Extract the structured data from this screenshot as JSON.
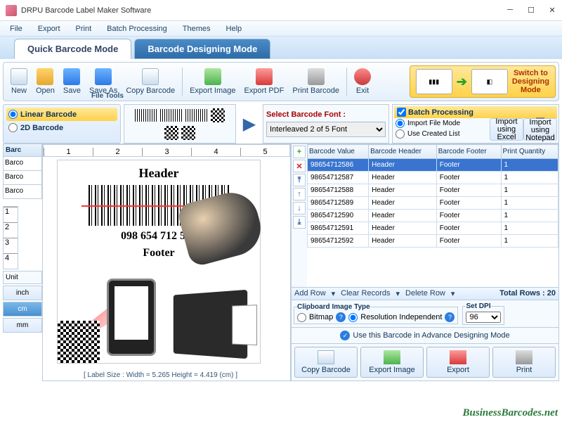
{
  "window": {
    "title": "DRPU Barcode Label Maker Software"
  },
  "menu": [
    "File",
    "Export",
    "Print",
    "Batch Processing",
    "Themes",
    "Help"
  ],
  "tabs": {
    "quick": "Quick Barcode Mode",
    "design": "Barcode Designing Mode"
  },
  "toolbar": {
    "new": "New",
    "open": "Open",
    "save": "Save",
    "saveas": "Save As",
    "copy": "Copy Barcode",
    "expimg": "Export Image",
    "exppdf": "Export PDF",
    "print": "Print Barcode",
    "exit": "Exit",
    "group": "File Tools"
  },
  "switch": {
    "line1": "Switch to",
    "line2": "Designing",
    "line3": "Mode"
  },
  "type": {
    "linear": "Linear Barcode",
    "twod": "2D Barcode"
  },
  "font": {
    "label": "Select Barcode Font :",
    "value": "Interleaved 2 of 5 Font"
  },
  "batch": {
    "title": "Batch Processing",
    "mode1": "Import File Mode",
    "mode2": "Use Created List",
    "imp1": "Import using Excel",
    "imp2": "Import using Notepad"
  },
  "left": {
    "hdr": "Barc",
    "r1": "Barco",
    "r2": "Barco",
    "r3": "Barco",
    "unit": "Unit",
    "inch": "inch",
    "cm": "cm",
    "mm": "mm"
  },
  "preview": {
    "header": "Header",
    "number": "098 654 712 586",
    "footer": "Footer"
  },
  "labelsize": "[ Label Size : Width = 5.265 Height = 4.419 (cm) ]",
  "table": {
    "cols": [
      "Barcode Value",
      "Barcode Header",
      "Barcode Footer",
      "Print Quantity"
    ],
    "rows": [
      [
        "98654712586",
        "Header",
        "Footer",
        "1"
      ],
      [
        "98654712587",
        "Header",
        "Footer",
        "1"
      ],
      [
        "98654712588",
        "Header",
        "Footer",
        "1"
      ],
      [
        "98654712589",
        "Header",
        "Footer",
        "1"
      ],
      [
        "98654712590",
        "Header",
        "Footer",
        "1"
      ],
      [
        "98654712591",
        "Header",
        "Footer",
        "1"
      ],
      [
        "98654712592",
        "Header",
        "Footer",
        "1"
      ]
    ],
    "addrow": "Add Row",
    "clear": "Clear Records",
    "delrow": "Delete Row",
    "total": "Total Rows : 20"
  },
  "clip": {
    "title": "Clipboard Image Type",
    "bitmap": "Bitmap",
    "res": "Resolution Independent",
    "dpi": "Set DPI",
    "dpival": "96"
  },
  "adv": "Use this Barcode in Advance Designing Mode",
  "actions": {
    "copy": "Copy Barcode",
    "expimg": "Export Image",
    "exppdf": "Export",
    "print": "Print"
  },
  "watermark": "BusinessBarcodes.net"
}
